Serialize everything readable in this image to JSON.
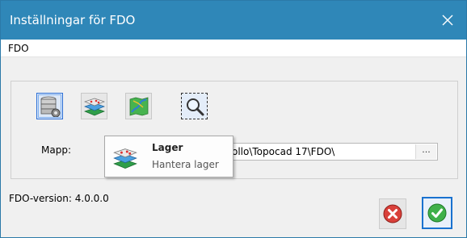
{
  "window": {
    "title": "Inställningar för FDO",
    "accent_color": "#2f87b8",
    "close_icon": "close-icon"
  },
  "menubar": {
    "items": [
      {
        "label": "FDO"
      }
    ]
  },
  "toolbar": {
    "buttons": [
      {
        "name": "database-settings",
        "icon": "database-gear-icon",
        "state": "selected"
      },
      {
        "name": "layers",
        "icon": "layers-icon",
        "state": "normal"
      },
      {
        "name": "map",
        "icon": "map-icon",
        "state": "normal"
      },
      {
        "name": "zoom",
        "icon": "magnifier-icon",
        "state": "focused"
      }
    ]
  },
  "tooltip": {
    "title": "Lager",
    "description": "Hantera lager",
    "icon": "layers-icon"
  },
  "folder": {
    "label": "Mapp:",
    "value_visible": "ollo\\Topocad 17\\FDO\\",
    "browse_label": "..."
  },
  "footer": {
    "version_text": "FDO-version: 4.0.0.0",
    "cancel_icon": "cancel-icon",
    "ok_icon": "checkmark-icon"
  }
}
